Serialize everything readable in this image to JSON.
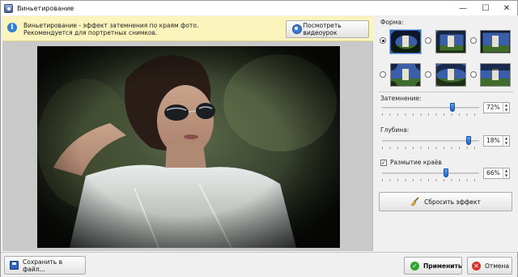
{
  "window": {
    "title": "Виньетирование",
    "controls": {
      "minimize": "—",
      "maximize": "☐",
      "close": "✕"
    }
  },
  "banner": {
    "line1": "Виньетирование - эффект затемнения по краям фото.",
    "line2": "Рекомендуется для портретных снимков.",
    "video_button": "Посмотреть видеоурок",
    "info_glyph": "i"
  },
  "panel": {
    "shape_label": "Форма:",
    "shapes": [
      {
        "name": "vignette-oval",
        "selected": true
      },
      {
        "name": "vignette-rect-soft",
        "selected": false
      },
      {
        "name": "vignette-rect-hard",
        "selected": false
      },
      {
        "name": "vignette-corners",
        "selected": false
      },
      {
        "name": "vignette-wide",
        "selected": false
      },
      {
        "name": "vignette-top",
        "selected": false
      }
    ],
    "darkening": {
      "label": "Затемнение:",
      "value": "72%",
      "level": 0.72
    },
    "depth": {
      "label": "Глубина:",
      "value": "18%",
      "level": 0.9
    },
    "blur": {
      "label": "Размытие краёв",
      "checked": true,
      "check_glyph": "✓",
      "value": "66%",
      "level": 0.66
    },
    "reset_button": "Сбросить эффект",
    "spin_up": "▲",
    "spin_down": "▼"
  },
  "footer": {
    "save_button": "Сохранить в файл...",
    "apply_button": "Применить",
    "cancel_button": "Отмена",
    "ok_glyph": "✓",
    "cancel_glyph": "✕"
  },
  "colors": {
    "accent": "#1f62c4",
    "banner_bg": "#fbf4bc",
    "apply_icon": "#2ea62e",
    "cancel_icon": "#d8322b"
  },
  "icons": [
    "app-icon",
    "info-icon",
    "camera-icon",
    "save-icon",
    "broom-icon",
    "check-icon",
    "cancel-icon"
  ]
}
